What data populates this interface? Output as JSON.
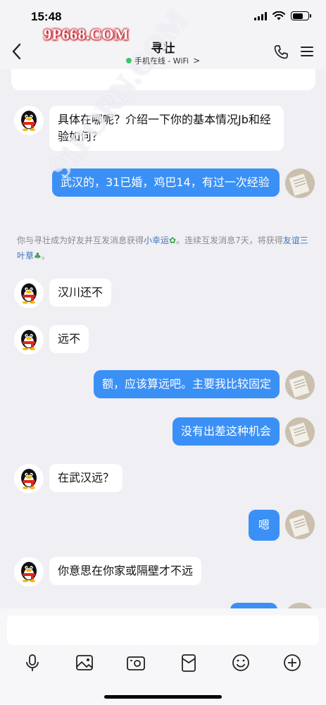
{
  "status_bar": {
    "time": "15:48"
  },
  "header": {
    "title": "寻壮",
    "online_status": "手机在线 - WiFi",
    "status_chevron": ">"
  },
  "watermark": {
    "primary": "9P668.COM",
    "diagonal": "91PORN.COM"
  },
  "messages": [
    {
      "side": "in",
      "text": "具体在哪呢？介绍一下你的基本情况Jb和经验如何？"
    },
    {
      "side": "out",
      "text": "武汉的，31已婚，鸡巴14，有过一次经验"
    },
    {
      "side": "in",
      "text": "汉川还不"
    },
    {
      "side": "in",
      "text": "远不"
    },
    {
      "side": "out",
      "text": "额，应该算远吧。主要我比较固定"
    },
    {
      "side": "out",
      "text": "没有出差这种机会"
    },
    {
      "side": "in",
      "text": "在武汉远？"
    },
    {
      "side": "out",
      "text": "嗯"
    },
    {
      "side": "in",
      "text": "你意思在你家或隔壁才不远"
    }
  ],
  "system_note": {
    "part1": "你与寻壮成为好友并互发消息获得",
    "link1": "小幸运",
    "part2": "。连续互发消息7天，将获得",
    "link2": "友谊三叶草"
  },
  "toolbar_icons": [
    "microphone-icon",
    "image-icon",
    "camera-icon",
    "red-packet-icon",
    "emoji-icon",
    "plus-icon"
  ],
  "colors": {
    "outgoing_bubble": "#3b90f5",
    "incoming_bubble": "#ffffff",
    "background": "#efeff4",
    "online_dot": "#3ac66a",
    "link": "#3f74b8"
  }
}
